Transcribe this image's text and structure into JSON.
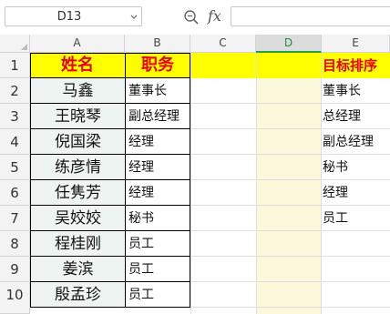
{
  "formula_bar": {
    "name_box": "D13",
    "zoom_icon": "zoom-icon",
    "fx_label": "fx",
    "formula": ""
  },
  "columns": [
    "A",
    "B",
    "C",
    "D",
    "E"
  ],
  "selected_column": "D",
  "rows": [
    "1",
    "2",
    "3",
    "4",
    "5",
    "6",
    "7",
    "8",
    "9",
    "10"
  ],
  "header": {
    "A": "姓名",
    "B": "职务",
    "E": "目标排序"
  },
  "table": [
    {
      "name": "马鑫",
      "role": "董事长"
    },
    {
      "name": "王晓琴",
      "role": "副总经理"
    },
    {
      "name": "倪国梁",
      "role": "经理"
    },
    {
      "name": "练彦情",
      "role": "经理"
    },
    {
      "name": "任隽芳",
      "role": "经理"
    },
    {
      "name": "吴姣姣",
      "role": "秘书"
    },
    {
      "name": "程桂刚",
      "role": "员工"
    },
    {
      "name": "姜滨",
      "role": "员工"
    },
    {
      "name": "殷孟珍",
      "role": "员工"
    }
  ],
  "target_order": [
    "董事长",
    "总经理",
    "副总经理",
    "秘书",
    "经理",
    "员工"
  ],
  "colors": {
    "header_fill": "#ffff00",
    "header_text": "#e8000b",
    "column_d_fill": "#fbf8dc",
    "selected_header_text": "#1f8f3a"
  }
}
